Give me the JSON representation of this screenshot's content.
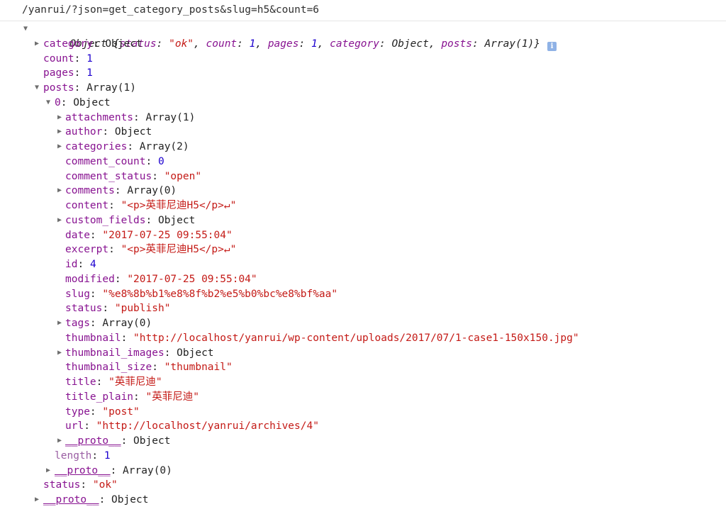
{
  "url": "/yanrui/?json=get_category_posts&slug=h5&count=6",
  "root": {
    "type": "Object",
    "summary": [
      {
        "k": "status",
        "v": "\"ok\"",
        "t": "str"
      },
      {
        "k": "count",
        "v": "1",
        "t": "num"
      },
      {
        "k": "pages",
        "v": "1",
        "t": "num"
      },
      {
        "k": "category",
        "v": "Object",
        "t": "obj"
      },
      {
        "k": "posts",
        "v": "Array(1)",
        "t": "obj"
      }
    ]
  },
  "rows": [
    {
      "depth": 1,
      "tri": "right",
      "key": "category",
      "val": "Object",
      "t": "obj"
    },
    {
      "depth": 1,
      "tri": "",
      "key": "count",
      "val": "1",
      "t": "num"
    },
    {
      "depth": 1,
      "tri": "",
      "key": "pages",
      "val": "1",
      "t": "num"
    },
    {
      "depth": 1,
      "tri": "down",
      "key": "posts",
      "val": "Array(1)",
      "t": "obj"
    },
    {
      "depth": 2,
      "tri": "down",
      "key": "0",
      "val": "Object",
      "t": "obj"
    },
    {
      "depth": 3,
      "tri": "right",
      "key": "attachments",
      "val": "Array(1)",
      "t": "obj"
    },
    {
      "depth": 3,
      "tri": "right",
      "key": "author",
      "val": "Object",
      "t": "obj"
    },
    {
      "depth": 3,
      "tri": "right",
      "key": "categories",
      "val": "Array(2)",
      "t": "obj"
    },
    {
      "depth": 3,
      "tri": "",
      "key": "comment_count",
      "val": "0",
      "t": "num"
    },
    {
      "depth": 3,
      "tri": "",
      "key": "comment_status",
      "val": "\"open\"",
      "t": "str"
    },
    {
      "depth": 3,
      "tri": "right",
      "key": "comments",
      "val": "Array(0)",
      "t": "obj"
    },
    {
      "depth": 3,
      "tri": "",
      "key": "content",
      "val": "\"<p>英菲尼迪H5</p>↵\"",
      "t": "str"
    },
    {
      "depth": 3,
      "tri": "right",
      "key": "custom_fields",
      "val": "Object",
      "t": "obj"
    },
    {
      "depth": 3,
      "tri": "",
      "key": "date",
      "val": "\"2017-07-25 09:55:04\"",
      "t": "str"
    },
    {
      "depth": 3,
      "tri": "",
      "key": "excerpt",
      "val": "\"<p>英菲尼迪H5</p>↵\"",
      "t": "str"
    },
    {
      "depth": 3,
      "tri": "",
      "key": "id",
      "val": "4",
      "t": "num"
    },
    {
      "depth": 3,
      "tri": "",
      "key": "modified",
      "val": "\"2017-07-25 09:55:04\"",
      "t": "str"
    },
    {
      "depth": 3,
      "tri": "",
      "key": "slug",
      "val": "\"%e8%8b%b1%e8%8f%b2%e5%b0%bc%e8%bf%aa\"",
      "t": "str"
    },
    {
      "depth": 3,
      "tri": "",
      "key": "status",
      "val": "\"publish\"",
      "t": "str"
    },
    {
      "depth": 3,
      "tri": "right",
      "key": "tags",
      "val": "Array(0)",
      "t": "obj"
    },
    {
      "depth": 3,
      "tri": "",
      "key": "thumbnail",
      "val": "\"http://localhost/yanrui/wp-content/uploads/2017/07/1-case1-150x150.jpg\"",
      "t": "str"
    },
    {
      "depth": 3,
      "tri": "right",
      "key": "thumbnail_images",
      "val": "Object",
      "t": "obj"
    },
    {
      "depth": 3,
      "tri": "",
      "key": "thumbnail_size",
      "val": "\"thumbnail\"",
      "t": "str"
    },
    {
      "depth": 3,
      "tri": "",
      "key": "title",
      "val": "\"英菲尼迪\"",
      "t": "str"
    },
    {
      "depth": 3,
      "tri": "",
      "key": "title_plain",
      "val": "\"英菲尼迪\"",
      "t": "str"
    },
    {
      "depth": 3,
      "tri": "",
      "key": "type",
      "val": "\"post\"",
      "t": "str"
    },
    {
      "depth": 3,
      "tri": "",
      "key": "url",
      "val": "\"http://localhost/yanrui/archives/4\"",
      "t": "str"
    },
    {
      "depth": 3,
      "tri": "right",
      "key": "__proto__",
      "val": "Object",
      "t": "obj",
      "proto": true
    },
    {
      "depth": 2,
      "tri": "",
      "key": "length",
      "val": "1",
      "t": "num",
      "dim": true
    },
    {
      "depth": 2,
      "tri": "right",
      "key": "__proto__",
      "val": "Array(0)",
      "t": "obj",
      "proto": true
    },
    {
      "depth": 1,
      "tri": "",
      "key": "status",
      "val": "\"ok\"",
      "t": "str"
    },
    {
      "depth": 1,
      "tri": "right",
      "key": "__proto__",
      "val": "Object",
      "t": "obj",
      "proto": true
    }
  ],
  "glyphs": {
    "tri_right": "▶",
    "tri_down": "▼",
    "info": "i"
  },
  "colors": {
    "key": "#881391",
    "string": "#c41a16",
    "number": "#1c00cf",
    "info_badge": "#8fb2e6"
  }
}
